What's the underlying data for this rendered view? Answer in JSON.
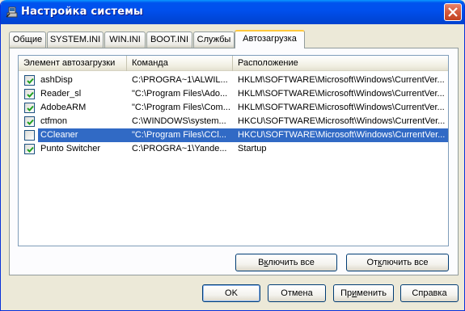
{
  "window": {
    "title": "Настройка системы"
  },
  "tabs": [
    {
      "label": "Общие"
    },
    {
      "label": "SYSTEM.INI"
    },
    {
      "label": "WIN.INI"
    },
    {
      "label": "BOOT.INI"
    },
    {
      "label": "Службы"
    },
    {
      "label": "Автозагрузка",
      "active": true
    }
  ],
  "list": {
    "columns": [
      "Элемент автозагрузки",
      "Команда",
      "Расположение"
    ],
    "rows": [
      {
        "checked": true,
        "name": "ashDisp",
        "command": "C:\\PROGRA~1\\ALWIL...",
        "location": "HKLM\\SOFTWARE\\Microsoft\\Windows\\CurrentVer..."
      },
      {
        "checked": true,
        "name": "Reader_sl",
        "command": "\"C:\\Program Files\\Ado...",
        "location": "HKLM\\SOFTWARE\\Microsoft\\Windows\\CurrentVer..."
      },
      {
        "checked": true,
        "name": "AdobeARM",
        "command": "\"C:\\Program Files\\Com...",
        "location": "HKLM\\SOFTWARE\\Microsoft\\Windows\\CurrentVer..."
      },
      {
        "checked": true,
        "name": "ctfmon",
        "command": "C:\\WINDOWS\\system...",
        "location": "HKCU\\SOFTWARE\\Microsoft\\Windows\\CurrentVer..."
      },
      {
        "checked": false,
        "name": "CCleaner",
        "command": "\"C:\\Program Files\\CCl...",
        "location": "HKCU\\SOFTWARE\\Microsoft\\Windows\\CurrentVer...",
        "selected": true
      },
      {
        "checked": true,
        "name": "Punto Switcher",
        "command": "C:\\PROGRA~1\\Yande...",
        "location": "Startup"
      }
    ]
  },
  "buttons": {
    "enable_all": {
      "pre": "В",
      "ul": "к",
      "post": "лючить все"
    },
    "disable_all": {
      "pre": "От",
      "ul": "к",
      "post": "лючить все"
    },
    "ok": "OK",
    "cancel": "Отмена",
    "apply": {
      "pre": "Пр",
      "ul": "и",
      "post": "менить"
    },
    "help": "Справка"
  },
  "colors": {
    "selection": "#316AC5",
    "titlebar": "#0053EE",
    "tab_accent": "#FFC83C"
  }
}
